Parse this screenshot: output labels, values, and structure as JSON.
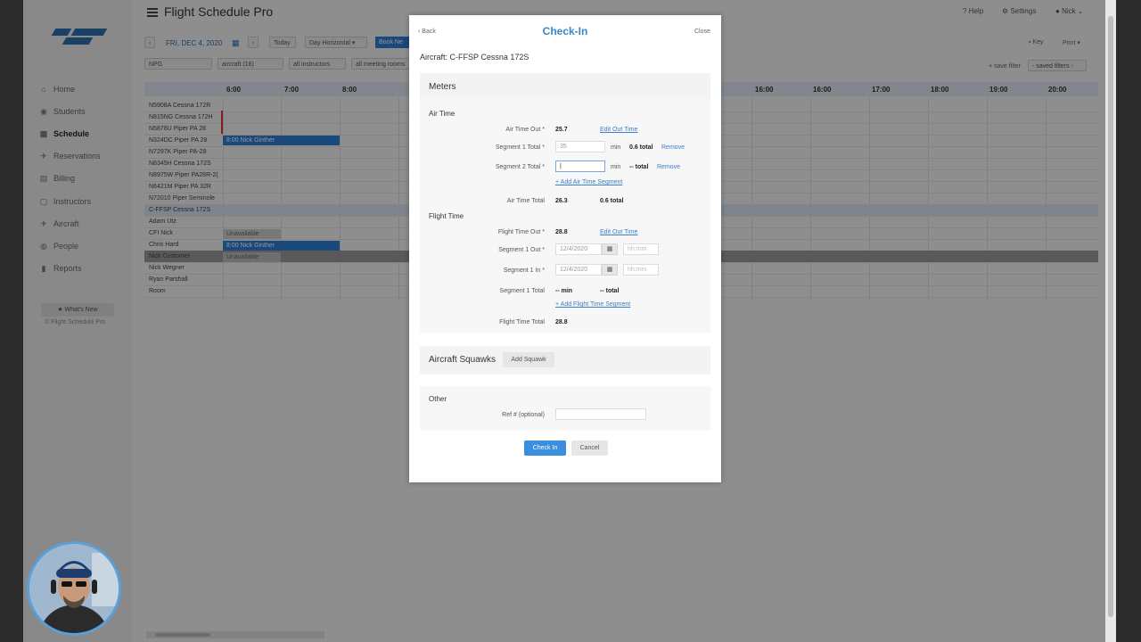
{
  "app": {
    "title": "Flight Schedule Pro",
    "help": "Help",
    "settings": "Settings",
    "user": "Nick"
  },
  "toolbar": {
    "date": "FRI, DEC 4, 2020",
    "today": "Today",
    "view": "Day Horizontal",
    "book": "Book Ne",
    "location": "NPG",
    "aircraft_filter": "aircraft (18)",
    "instructor_filter": "all instructors",
    "meeting_filter": "all meeting rooms",
    "key": "Key",
    "print": "Print",
    "save_filter": "+ save filter",
    "saved_filters": "- saved filters -"
  },
  "sidebar": {
    "items": [
      {
        "label": "Home",
        "icon": "home-icon"
      },
      {
        "label": "Students",
        "icon": "students-icon"
      },
      {
        "label": "Schedule",
        "icon": "calendar-icon"
      },
      {
        "label": "Reservations",
        "icon": "plane-icon"
      },
      {
        "label": "Billing",
        "icon": "billing-icon"
      },
      {
        "label": "Instructors",
        "icon": "instructor-icon"
      },
      {
        "label": "Aircraft",
        "icon": "aircraft-icon"
      },
      {
        "label": "People",
        "icon": "people-icon"
      },
      {
        "label": "Reports",
        "icon": "chart-icon"
      }
    ],
    "whats_new": "★ What's New",
    "copyright": "© Flight Schedule Pro"
  },
  "schedule": {
    "times": [
      "6:00",
      "7:00",
      "8:00",
      "16:00",
      "16:00",
      "17:00",
      "18:00",
      "19:00",
      "20:00"
    ],
    "rows": [
      "N5908A  Cessna 172R",
      "N815NG  Cessna 172H",
      "N5878U  Piper PA 28",
      "N324DC  Piper PA 28",
      "N7297K  Piper PA-28",
      "N8345H  Cessna 172S",
      "N8975W  Piper PA28R-2(",
      "N6421M  Piper PA 32R",
      "N72010  Piper Seminole",
      "C-FFSP  Cessna 172S",
      "Adam Utz",
      "CFI Nick",
      "Chris Hard",
      "Nick Customer",
      "Nick Wegner",
      "Ryan Parshall",
      "Room"
    ],
    "events": {
      "ev1": "8:00 Nick Ginther",
      "ev2": "8:00 Nick Ginther",
      "unavailable1": "Unavailable",
      "unavailable2": "Unavailable"
    }
  },
  "modal": {
    "back": "Back",
    "title": "Check-In",
    "close": "Close",
    "aircraft": "Aircraft: C-FFSP Cessna 172S",
    "meters": "Meters",
    "air_time": {
      "heading": "Air Time",
      "out_label": "Air Time Out *",
      "out_value": "25.7",
      "edit_out": "Edit Out Time",
      "seg1_label": "Segment 1 Total *",
      "seg1_value": "35",
      "seg1_unit": "min",
      "seg1_total": "0.6 total",
      "seg1_remove": "Remove",
      "seg2_label": "Segment 2 Total *",
      "seg2_value": "|",
      "seg2_unit": "min",
      "seg2_total": "-- total",
      "seg2_remove": "Remove",
      "add_segment": "+ Add Air Time Segment",
      "total_label": "Air Time Total",
      "total_value": "26.3",
      "total_hours": "0.6 total"
    },
    "flight_time": {
      "heading": "Flight Time",
      "out_label": "Flight Time Out *",
      "out_value": "28.8",
      "edit_out": "Edit Out Time",
      "seg1_out_label": "Segment 1 Out *",
      "seg1_out_date": "12/4/2020",
      "seg1_out_time_ph": "hh:mm",
      "seg1_in_label": "Segment 1 In *",
      "seg1_in_date": "12/4/2020",
      "seg1_in_time_ph": "hh:mm",
      "seg1_total_label": "Segment 1 Total",
      "seg1_total_min": "-- min",
      "seg1_total": "-- total",
      "add_segment": "+ Add Flight Time Segment",
      "total_label": "Flight Time Total",
      "total_value": "28.8"
    },
    "squawks": {
      "heading": "Aircraft Squawks",
      "add": "Add Squawk"
    },
    "other": {
      "heading": "Other",
      "ref_label": "Ref # (optional)",
      "ref_value": ""
    },
    "check_in": "Check In",
    "cancel": "Cancel"
  },
  "colors": {
    "accent": "#3a86c8",
    "primary_button": "#3a8ee0",
    "event_bar": "#2f7fd6"
  }
}
